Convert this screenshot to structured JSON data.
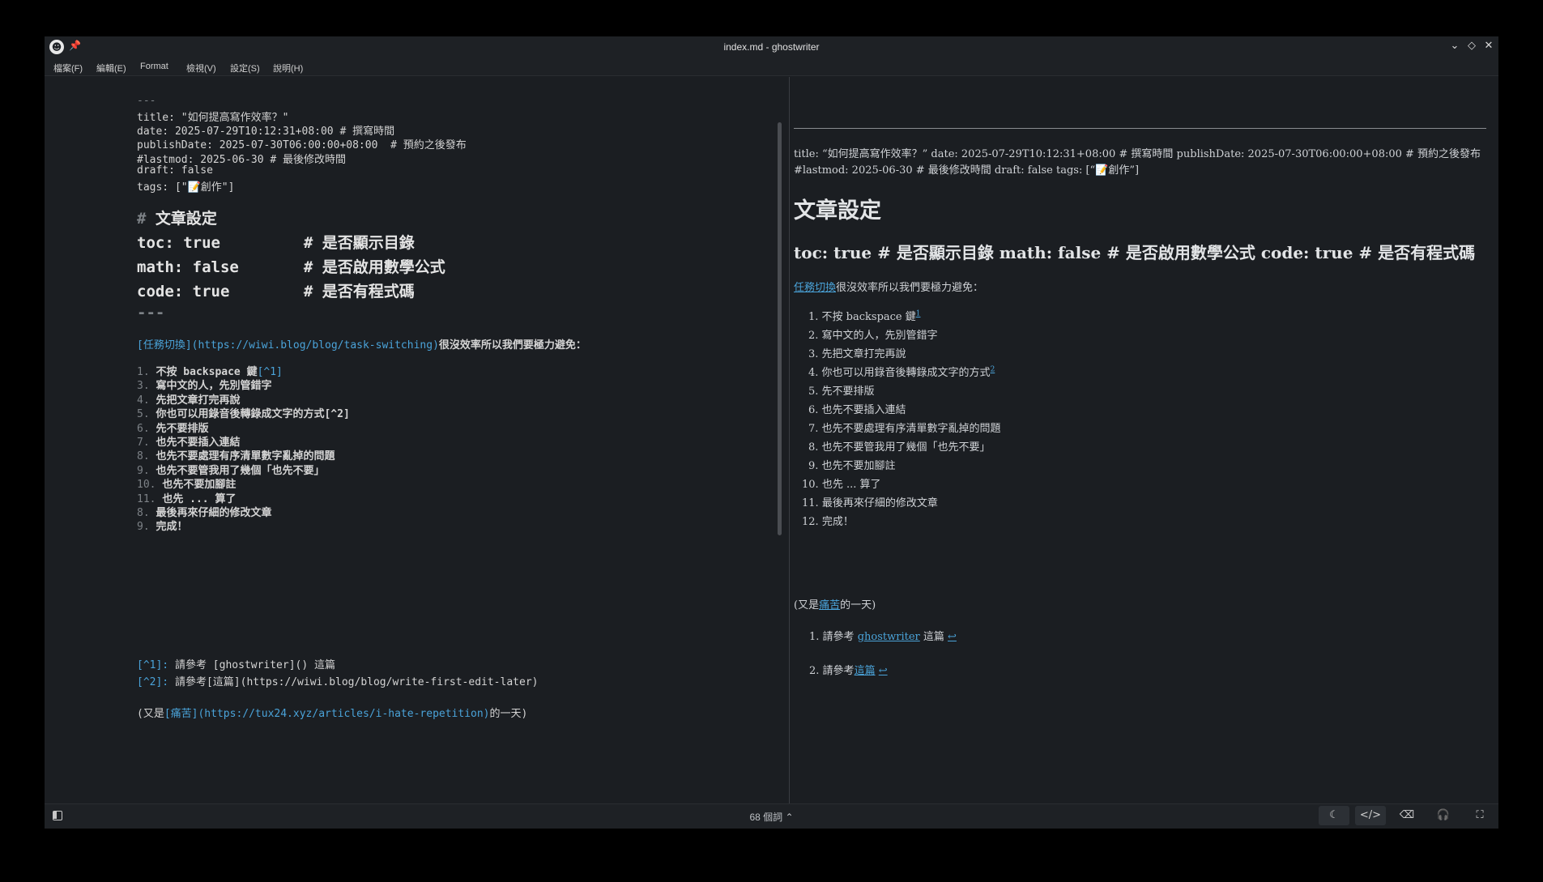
{
  "window": {
    "title": "index.md - ghostwriter",
    "app_icon": "ghost-icon",
    "pin_icon": "pin-icon"
  },
  "menu": [
    "檔案(F)",
    "編輯(E)",
    "Format",
    "檢視(V)",
    "設定(S)",
    "說明(H)"
  ],
  "editor": {
    "fm_open": "---",
    "fm_title": "title: \"如何提高寫作效率？\"",
    "fm_date": "date: 2025-07-29T10:12:31+08:00 # 撰寫時間",
    "fm_publish": "publishDate: 2025-07-30T06:00:00+08:00  # 預約之後發布",
    "fm_lastmod": "#lastmod: 2025-06-30 # 最後修改時間",
    "fm_draft": "draft: false",
    "fm_tags": "tags: [\"📝創作\"]",
    "h1_hash": "#",
    "h1_text": "文章設定",
    "toc_line": "toc: true         # 是否顯示目錄",
    "math_line": "math: false       # 是否啟用數學公式",
    "code_line": "code: true        # 是否有程式碼",
    "fm_close": "---",
    "intro_link": "[任務切換](https://wiwi.blog/blog/task-switching)",
    "intro_rest": "很沒效率所以我們要極力避免：",
    "list": [
      {
        "num": "1.",
        "text": "不按 backspace 鍵",
        "ref": "[^1]"
      },
      {
        "num": "3.",
        "text": "寫中文的人，先別管錯字",
        "ref": ""
      },
      {
        "num": "4.",
        "text": "先把文章打完再說",
        "ref": ""
      },
      {
        "num": "5.",
        "text": "你也可以用錄音後轉錄成文字的方式[^2]",
        "ref": ""
      },
      {
        "num": "6.",
        "text": "先不要排版",
        "ref": ""
      },
      {
        "num": "7.",
        "text": "也先不要插入連結",
        "ref": ""
      },
      {
        "num": "8.",
        "text": "也先不要處理有序清單數字亂掉的問題",
        "ref": ""
      },
      {
        "num": "9.",
        "text": "也先不要管我用了幾個「也先不要」",
        "ref": ""
      },
      {
        "num": "10.",
        "text": "也先不要加腳註",
        "ref": ""
      },
      {
        "num": "11.",
        "text": "也先 ... 算了",
        "ref": ""
      },
      {
        "num": "8.",
        "text": "最後再來仔細的修改文章",
        "ref": ""
      },
      {
        "num": "9.",
        "text": "完成！",
        "ref": ""
      }
    ],
    "fn1_ref": "[^1]:",
    "fn1_text": " 請參考 [ghostwriter]() 這篇",
    "fn2_ref": "[^2]:",
    "fn2_text": " 請參考[這篇](https://wiwi.blog/blog/write-first-edit-later)",
    "tail_open": "(又是",
    "tail_link": "[痛苦](https://tux24.xyz/articles/i-hate-repetition)",
    "tail_close": "的一天)"
  },
  "preview": {
    "fm_line1": "title: “如何提高寫作效率？” date: 2025-07-29T10:12:31+08:00 # 撰寫時間 publishDate: 2025-07-30T06:00:00+08:00 # 預約之後發布",
    "fm_line2": "#lastmod: 2025-06-30 # 最後修改時間 draft: false tags: [“📝創作”]",
    "h1": "文章設定",
    "h2": "toc: true # 是否顯示目錄 math: false # 是否啟用數學公式 code: true # 是否有程式碼",
    "intro_link": "任務切換",
    "intro_rest": "很沒效率所以我們要極力避免：",
    "list": [
      {
        "num": "1.",
        "text": "不按 backspace 鍵",
        "sup": "1"
      },
      {
        "num": "2.",
        "text": "寫中文的人，先別管錯字",
        "sup": ""
      },
      {
        "num": "3.",
        "text": "先把文章打完再說",
        "sup": ""
      },
      {
        "num": "4.",
        "text": "你也可以用錄音後轉錄成文字的方式",
        "sup": "2"
      },
      {
        "num": "5.",
        "text": "先不要排版",
        "sup": ""
      },
      {
        "num": "6.",
        "text": "也先不要插入連結",
        "sup": ""
      },
      {
        "num": "7.",
        "text": "也先不要處理有序清單數字亂掉的問題",
        "sup": ""
      },
      {
        "num": "8.",
        "text": "也先不要管我用了幾個「也先不要」",
        "sup": ""
      },
      {
        "num": "9.",
        "text": "也先不要加腳註",
        "sup": ""
      },
      {
        "num": "10.",
        "text": "也先 ... 算了",
        "sup": ""
      },
      {
        "num": "11.",
        "text": "最後再來仔細的修改文章",
        "sup": ""
      },
      {
        "num": "12.",
        "text": "完成！",
        "sup": ""
      }
    ],
    "tail_open": "(又是",
    "tail_link": "痛苦",
    "tail_close": "的一天)",
    "fn1_num": "1.",
    "fn1_pre": "請參考 ",
    "fn1_link": "ghostwriter",
    "fn1_post": " 這篇 ",
    "fn2_num": "2.",
    "fn2_pre": "請參考",
    "fn2_link": "這篇",
    "backref": "↩"
  },
  "status": {
    "word_count": "68 個詞",
    "buttons": [
      "moon-icon",
      "code-icon",
      "backspace-icon",
      "headphones-icon",
      "fullscreen-icon"
    ]
  },
  "colors": {
    "background": "#1b1e22",
    "link": "#4aa3d9",
    "muted": "#7d8287"
  }
}
